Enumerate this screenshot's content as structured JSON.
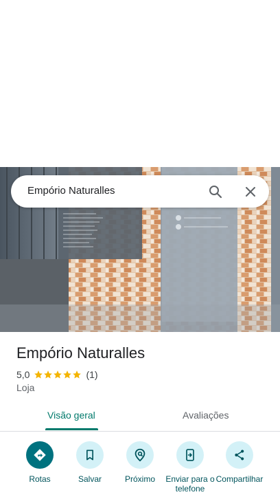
{
  "search": {
    "query": "Empório Naturalles"
  },
  "place": {
    "name": "Empório Naturalles",
    "rating": "5,0",
    "stars": 5,
    "review_count": "(1)",
    "category": "Loja"
  },
  "tabs": [
    {
      "label": "Visão geral",
      "active": true
    },
    {
      "label": "Avaliações",
      "active": false
    }
  ],
  "actions": [
    {
      "label": "Rotas",
      "icon": "directions-icon"
    },
    {
      "label": "Salvar",
      "icon": "bookmark-icon"
    },
    {
      "label": "Próximo",
      "icon": "nearby-icon"
    },
    {
      "label": "Enviar para o telefone",
      "icon": "send-to-phone-icon"
    },
    {
      "label": "Compartilhar",
      "icon": "share-icon"
    }
  ],
  "colors": {
    "accent": "#00796b",
    "action_bg": "#d3f1f7",
    "primary_action": "#00727f",
    "star": "#f4b400"
  }
}
